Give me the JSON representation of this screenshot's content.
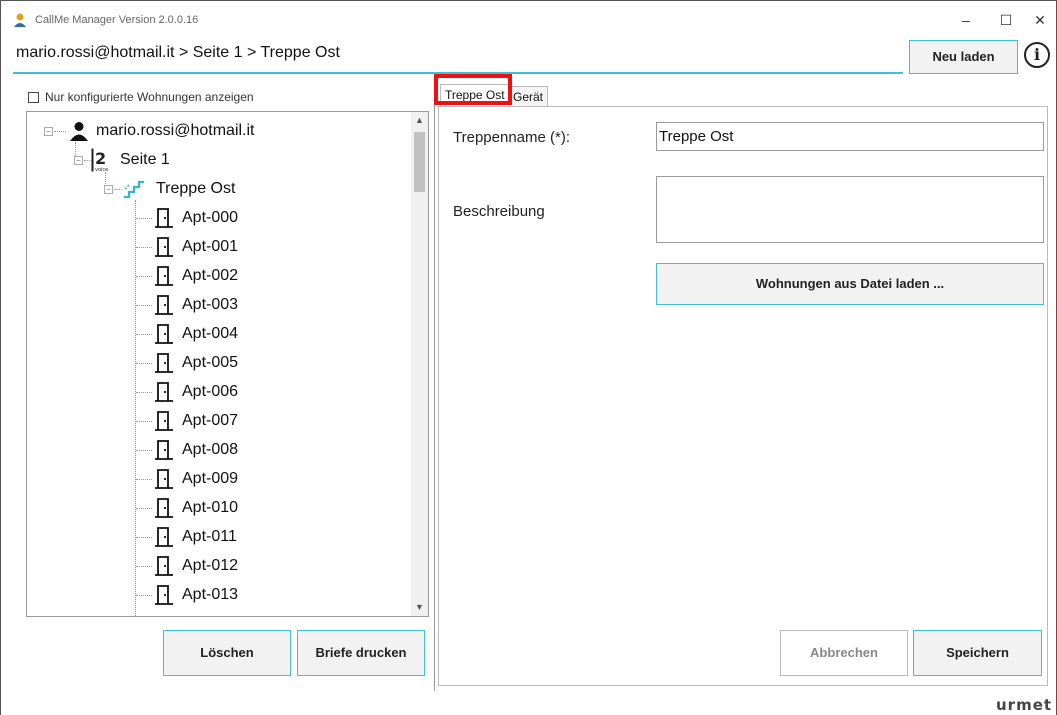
{
  "window": {
    "title": "CallMe Manager Version 2.0.0.16",
    "minimize": "–",
    "maximize": "☐",
    "close": "✕"
  },
  "header": {
    "breadcrumb": "mario.rossi@hotmail.it > Seite 1 > Treppe Ost",
    "reload_label": "Neu laden",
    "info_label": "i"
  },
  "left": {
    "filter_label": "Nur konfigurierte Wohnungen anzeigen",
    "tree": {
      "account": "mario.rossi@hotmail.it",
      "page": "Seite 1",
      "stairs": "Treppe Ost",
      "apartments": [
        "Apt-000",
        "Apt-001",
        "Apt-002",
        "Apt-003",
        "Apt-004",
        "Apt-005",
        "Apt-006",
        "Apt-007",
        "Apt-008",
        "Apt-009",
        "Apt-010",
        "Apt-011",
        "Apt-012",
        "Apt-013"
      ]
    },
    "delete_label": "Löschen",
    "print_label": "Briefe drucken"
  },
  "tabs": [
    {
      "label": "Treppe Ost",
      "active": true
    },
    {
      "label": "Gerät",
      "active": false
    }
  ],
  "form": {
    "name_label": "Treppenname (*):",
    "name_value": "Treppe Ost",
    "description_label": "Beschreibung",
    "description_value": "",
    "load_label": "Wohnungen aus Datei laden ...",
    "cancel_label": "Abbrechen",
    "save_label": "Speichern"
  },
  "brand": "urmet",
  "colors": {
    "accent": "#3fbfd8",
    "highlight": "#ee1111",
    "stairs_icon": "#2fb6d6"
  }
}
